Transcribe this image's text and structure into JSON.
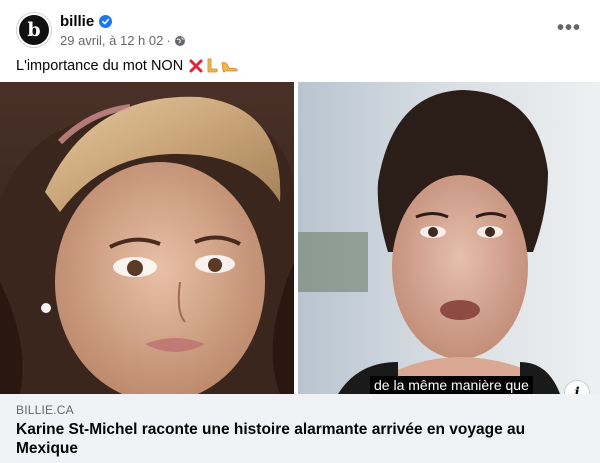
{
  "post": {
    "page_name": "billie",
    "avatar_letter": "b",
    "timestamp": "29 avril, à 12 h 02",
    "separator": "·",
    "privacy_icon": "globe-icon",
    "more_label": "•••",
    "caption": "L'importance du mot NON",
    "caption_emojis": [
      "cross-mark-emoji",
      "leg-emoji",
      "high-heel-emoji"
    ]
  },
  "media": {
    "left_photo": "portrait-photo-headscarf",
    "right_photo": "video-still-selfie",
    "subtitle": "de la même manière que",
    "info_label": "i"
  },
  "link_preview": {
    "domain": "BILLIE.CA",
    "title": "Karine St-Michel raconte une histoire alarmante arrivée en voyage au Mexique"
  },
  "colors": {
    "verified_blue": "#1877f2",
    "meta_gray": "#65676b",
    "link_box_bg": "#f0f2f5"
  }
}
